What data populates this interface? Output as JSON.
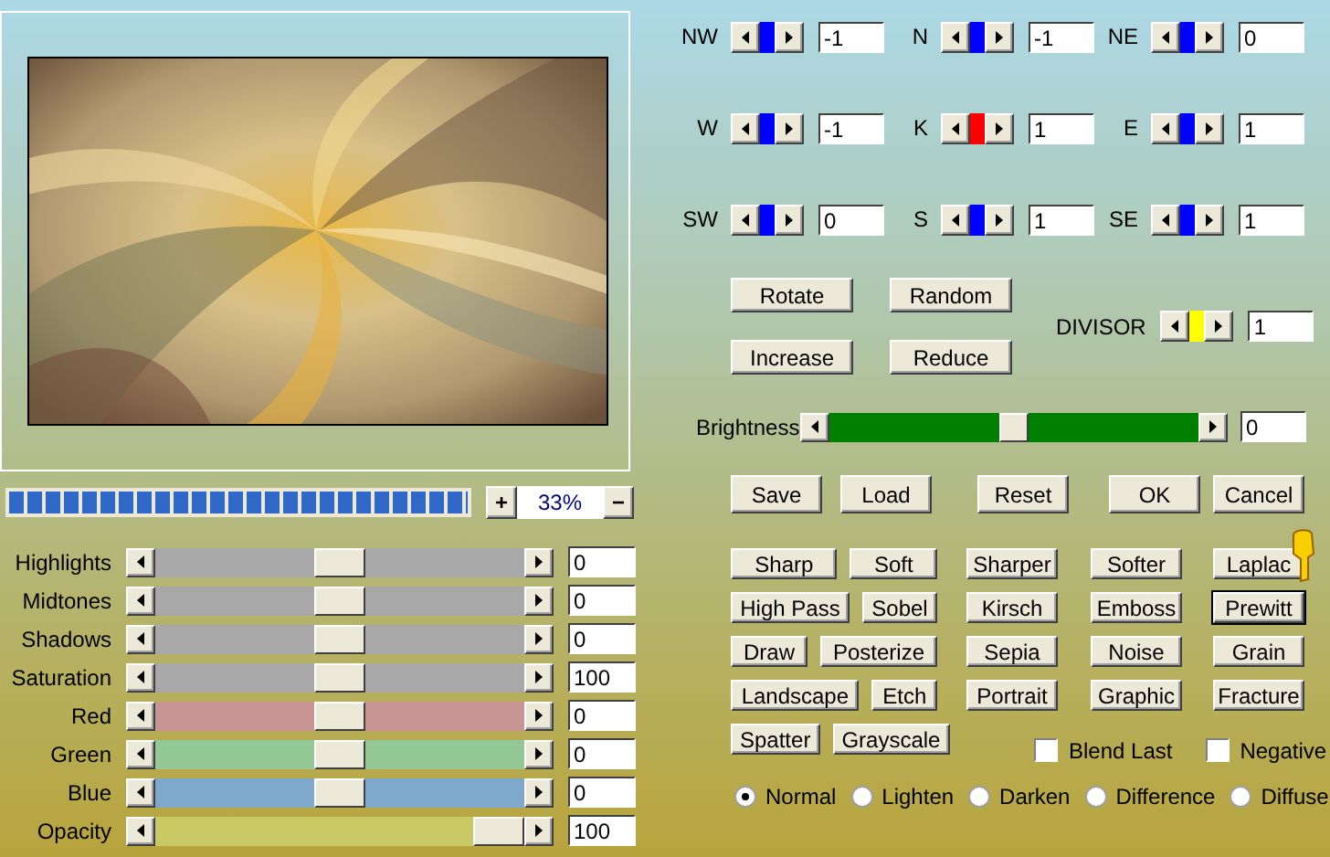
{
  "zoom": {
    "level": 1,
    "zoom_in": "+",
    "value": "33%",
    "zoom_out": "−"
  },
  "sliders": [
    {
      "label": "Highlights",
      "value": "0",
      "level": 0.5,
      "color": "#a8a8a8"
    },
    {
      "label": "Midtones",
      "value": "0",
      "level": 0.5,
      "color": "#a8a8a8"
    },
    {
      "label": "Shadows",
      "value": "0",
      "level": 0.5,
      "color": "#a8a8a8"
    },
    {
      "label": "Saturation",
      "value": "100",
      "level": 0.5,
      "color": "#a8a8a8"
    },
    {
      "label": "Red",
      "value": "0",
      "level": 0.5,
      "color": "#c89494"
    },
    {
      "label": "Green",
      "value": "0",
      "level": 0.5,
      "color": "#94c894"
    },
    {
      "label": "Blue",
      "value": "0",
      "level": 0.5,
      "color": "#7ea8cc"
    },
    {
      "label": "Opacity",
      "value": "100",
      "level": 1,
      "color": "#c8c864"
    }
  ],
  "kernel": [
    [
      {
        "label": "NW",
        "value": "-1",
        "color": "#0000ff"
      },
      {
        "label": "N",
        "value": "-1",
        "color": "#0000ff"
      },
      {
        "label": "NE",
        "value": "0",
        "color": "#0000ff"
      }
    ],
    [
      {
        "label": "W",
        "value": "-1",
        "color": "#0000ff"
      },
      {
        "label": "K",
        "value": "1",
        "color": "#ff0000"
      },
      {
        "label": "E",
        "value": "1",
        "color": "#0000ff"
      }
    ],
    [
      {
        "label": "SW",
        "value": "0",
        "color": "#0000ff"
      },
      {
        "label": "S",
        "value": "1",
        "color": "#0000ff"
      },
      {
        "label": "SE",
        "value": "1",
        "color": "#0000ff"
      }
    ]
  ],
  "kernel_buttons": [
    [
      "Rotate",
      "Random"
    ],
    [
      "Increase",
      "Reduce"
    ]
  ],
  "divisor": {
    "label": "DIVISOR",
    "value": "1",
    "color": "#ffff00"
  },
  "brightness": {
    "label": "Brightness",
    "value": "0",
    "level": 0.5
  },
  "actions": [
    "Save",
    "Load",
    "Reset",
    "OK",
    "Cancel"
  ],
  "filters": [
    [
      {
        "label": "Sharp",
        "focused": false
      },
      {
        "label": "Soft",
        "focused": false
      },
      {
        "label": "Sharper",
        "focused": false
      },
      {
        "label": "Softer",
        "focused": false
      },
      {
        "label": "Laplac",
        "focused": false
      }
    ],
    [
      {
        "label": "High Pass",
        "focused": false
      },
      {
        "label": "Sobel",
        "focused": false
      },
      {
        "label": "Kirsch",
        "focused": false
      },
      {
        "label": "Emboss",
        "focused": false
      },
      {
        "label": "Prewitt",
        "focused": true
      }
    ],
    [
      {
        "label": "Draw",
        "focused": false
      },
      {
        "label": "Posterize",
        "focused": false
      },
      {
        "label": "Sepia",
        "focused": false
      },
      {
        "label": "Noise",
        "focused": false
      },
      {
        "label": "Grain",
        "focused": false
      }
    ],
    [
      {
        "label": "Landscape",
        "focused": false
      },
      {
        "label": "Etch",
        "focused": false
      },
      {
        "label": "Portrait",
        "focused": false
      },
      {
        "label": "Graphic",
        "focused": false
      },
      {
        "label": "Fracture",
        "focused": false
      }
    ],
    [
      {
        "label": "Spatter",
        "focused": false
      },
      {
        "label": "Grayscale",
        "focused": false
      }
    ]
  ],
  "checkboxes": [
    {
      "label": "Blend Last",
      "checked": false
    },
    {
      "label": "Negative",
      "checked": false
    }
  ],
  "blend_modes": [
    {
      "label": "Normal",
      "selected": true
    },
    {
      "label": "Lighten",
      "selected": false
    },
    {
      "label": "Darken",
      "selected": false
    },
    {
      "label": "Difference",
      "selected": false
    },
    {
      "label": "Diffuse",
      "selected": false
    }
  ]
}
